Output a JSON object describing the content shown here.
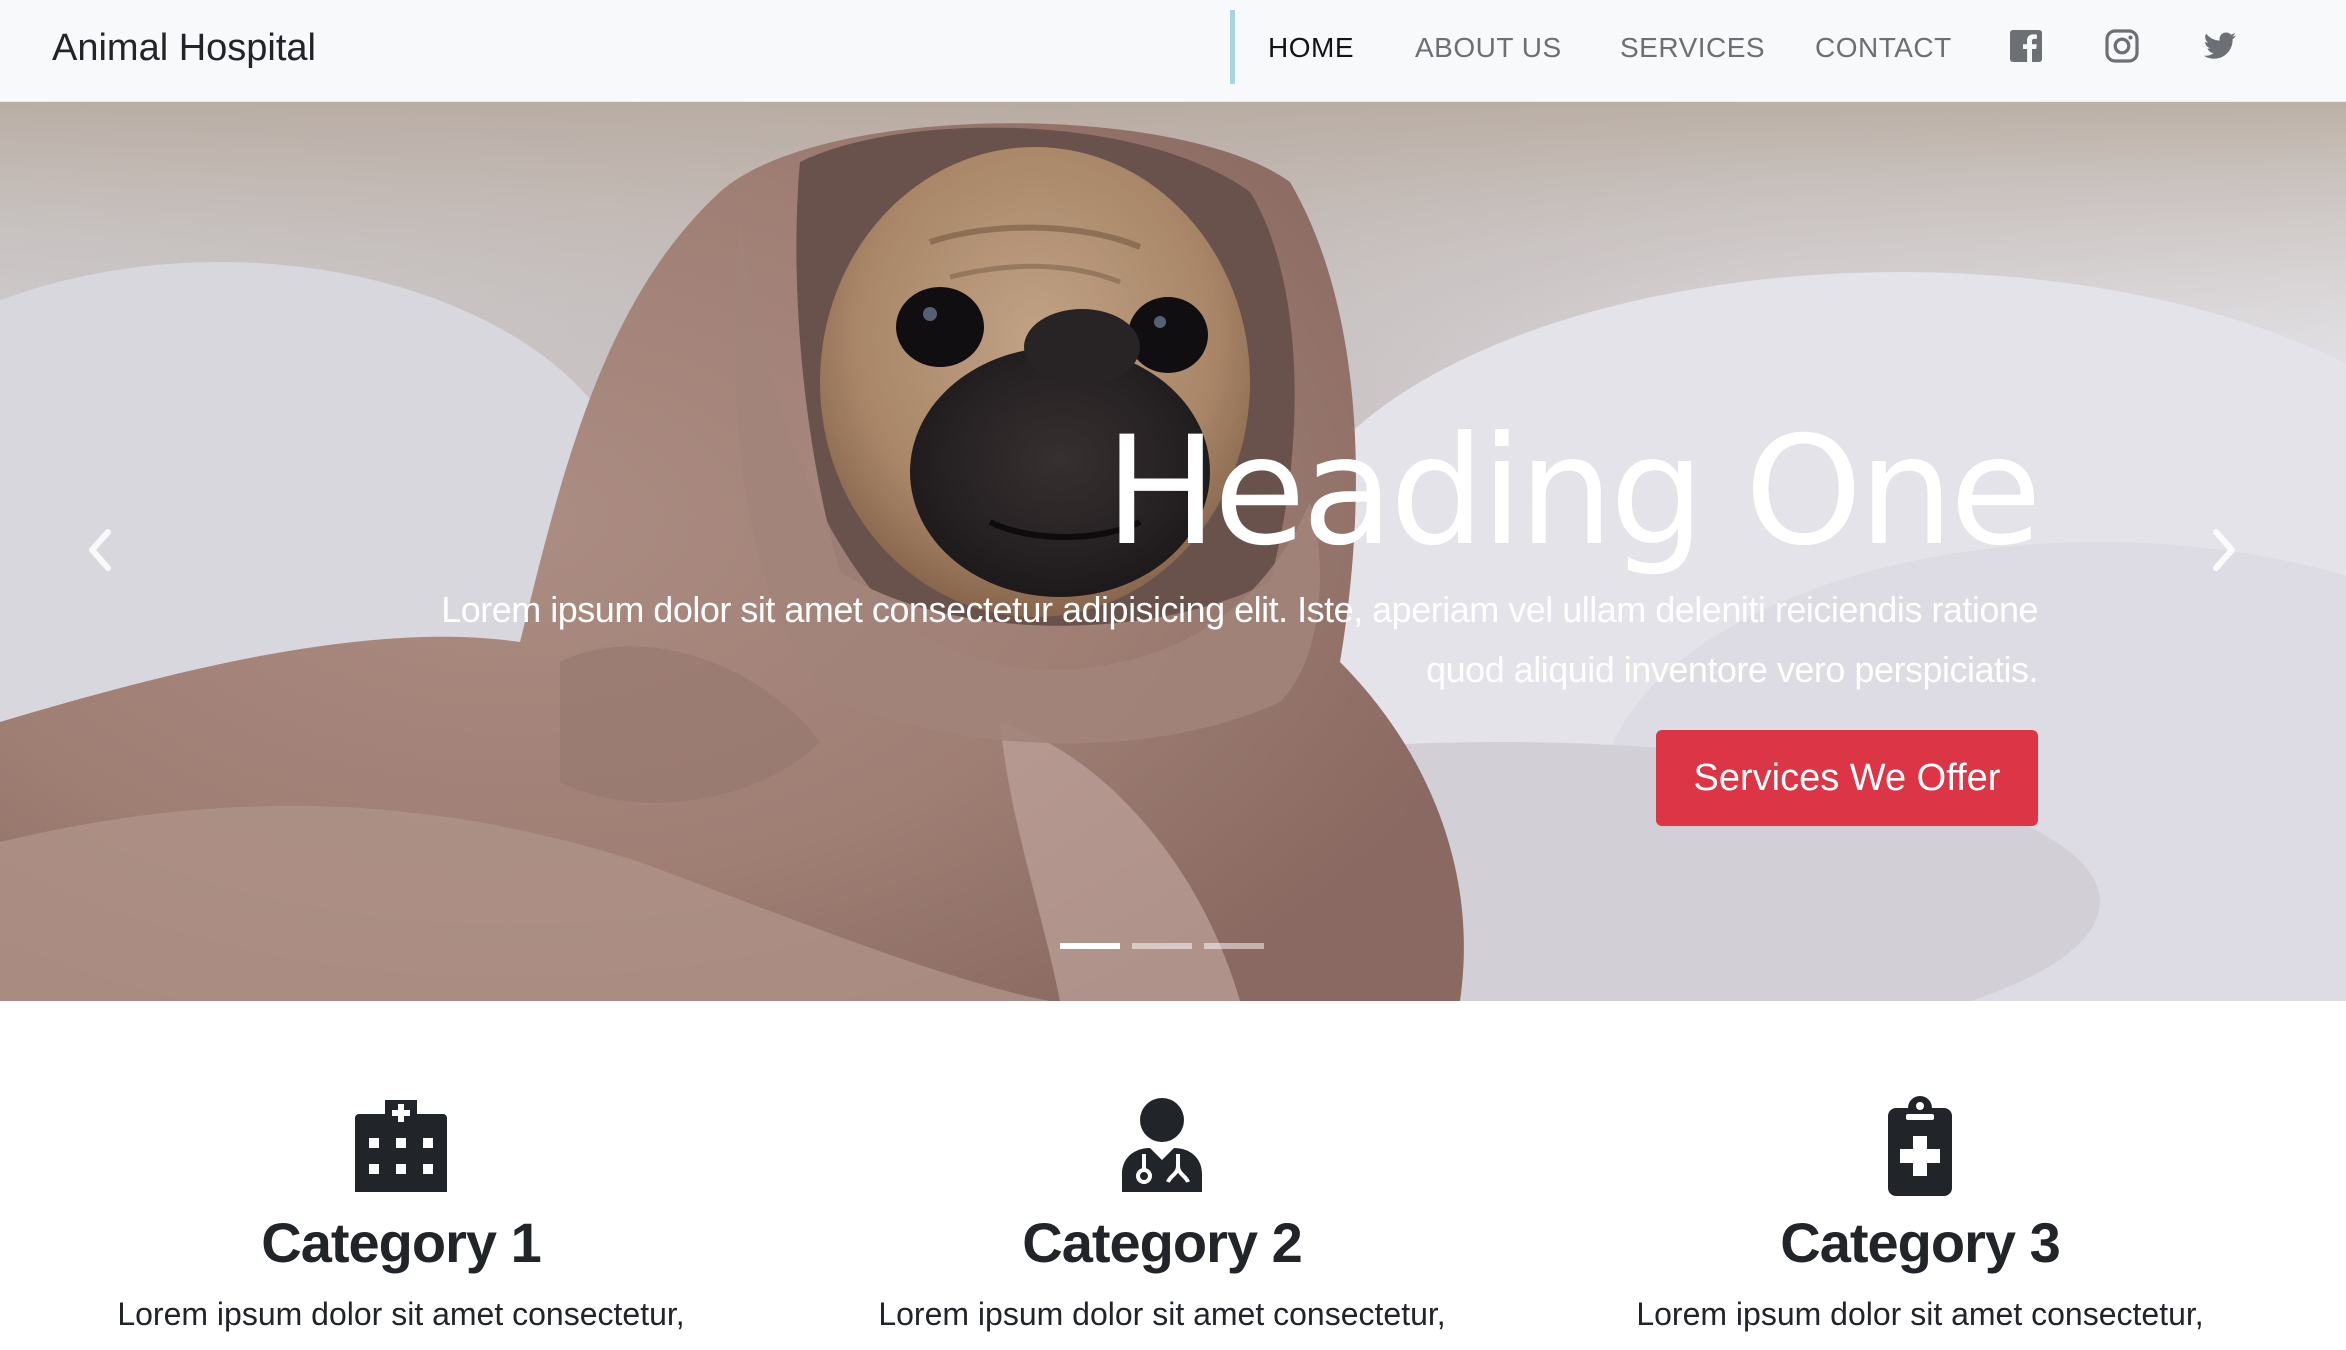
{
  "navbar": {
    "brand": "Animal Hospital",
    "links": [
      {
        "label": "HOME",
        "active": true
      },
      {
        "label": "ABOUT US",
        "active": false
      },
      {
        "label": "SERVICES",
        "active": false
      },
      {
        "label": "CONTACT",
        "active": false
      }
    ],
    "social_icons": [
      "facebook-icon",
      "instagram-icon",
      "twitter-icon"
    ]
  },
  "hero": {
    "heading": "Heading One",
    "text": "Lorem ipsum dolor sit amet consectetur adipisicing elit. Iste, aperiam vel ullam deleniti reiciendis ratione quod aliquid inventore vero perspiciatis.",
    "button_label": "Services We Offer",
    "button_color": "#dc3545",
    "slide_count": 3,
    "active_slide": 1
  },
  "categories": [
    {
      "title": "Category 1",
      "text": "Lorem ipsum dolor sit amet consectetur,",
      "icon": "hospital-icon"
    },
    {
      "title": "Category 2",
      "text": "Lorem ipsum dolor sit amet consectetur,",
      "icon": "doctor-icon"
    },
    {
      "title": "Category 3",
      "text": "Lorem ipsum dolor sit amet consectetur,",
      "icon": "clipboard-medical-icon"
    }
  ],
  "colors": {
    "navbar_bg": "#f8f9fa",
    "nav_divider": "#a8d4e0",
    "text_dark": "#212529",
    "nav_muted": "#6c6f73"
  }
}
